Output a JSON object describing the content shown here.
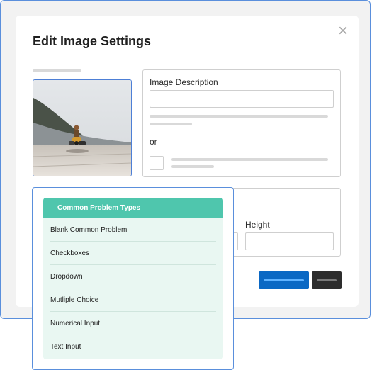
{
  "modal": {
    "title": "Edit Image Settings",
    "close_icon": "×"
  },
  "description_panel": {
    "label": "Image Description",
    "input_value": "",
    "or_text": "or"
  },
  "size_panel": {
    "height_label": "Height",
    "height_value": "",
    "width_value": ""
  },
  "dropdown": {
    "header": "Common Problem Types",
    "items": [
      "Blank Common Problem",
      "Checkboxes",
      "Dropdown",
      "Mutliple Choice",
      "Numerical Input",
      "Text Input"
    ]
  },
  "colors": {
    "accent_blue": "#0a68c4",
    "teal_header": "#4fc6ad",
    "dark_button": "#2d2d2d",
    "frame_border": "#5a8fdc"
  },
  "icons": {
    "close": "close-icon"
  }
}
